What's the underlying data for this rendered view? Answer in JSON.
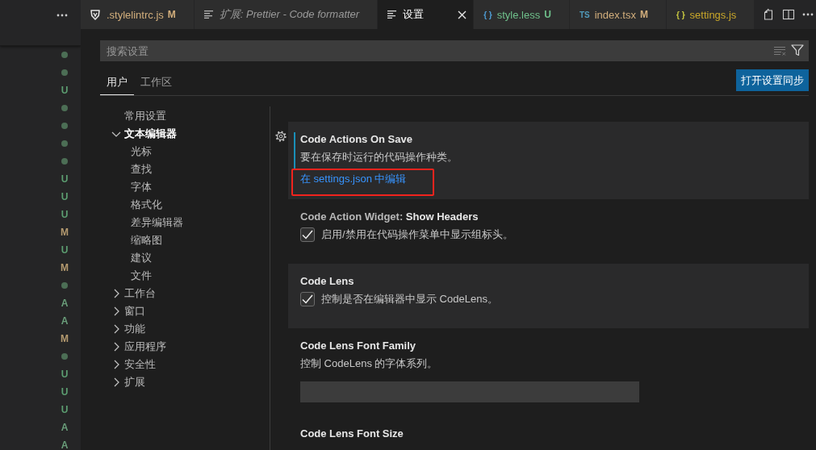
{
  "explorer": {
    "decorations": [
      {
        "kind": "dot",
        "color": "#4c6e55"
      },
      {
        "kind": "dot",
        "color": "#4c6e55"
      },
      {
        "kind": "letter",
        "label": "U",
        "color": "#5c9e71"
      },
      {
        "kind": "dot",
        "color": "#4c6e55"
      },
      {
        "kind": "dot",
        "color": "#4c6e55"
      },
      {
        "kind": "dot",
        "color": "#4c6e55"
      },
      {
        "kind": "dot",
        "color": "#4c6e55"
      },
      {
        "kind": "letter",
        "label": "U",
        "color": "#5c9e71"
      },
      {
        "kind": "letter",
        "label": "U",
        "color": "#5c9e71"
      },
      {
        "kind": "letter",
        "label": "U",
        "color": "#5c9e71"
      },
      {
        "kind": "letter",
        "label": "M",
        "color": "#b49a6f"
      },
      {
        "kind": "letter",
        "label": "U",
        "color": "#5c9e71"
      },
      {
        "kind": "letter",
        "label": "M",
        "color": "#b49a6f"
      },
      {
        "kind": "dot",
        "color": "#4c6e55"
      },
      {
        "kind": "letter",
        "label": "A",
        "color": "#6a9e7a"
      },
      {
        "kind": "letter",
        "label": "A",
        "color": "#6a9e7a"
      },
      {
        "kind": "letter",
        "label": "M",
        "color": "#b49a6f"
      },
      {
        "kind": "dot",
        "color": "#4c6e55"
      },
      {
        "kind": "letter",
        "label": "U",
        "color": "#5c9e71"
      },
      {
        "kind": "letter",
        "label": "U",
        "color": "#5c9e71"
      },
      {
        "kind": "letter",
        "label": "U",
        "color": "#5c9e71"
      },
      {
        "kind": "letter",
        "label": "A",
        "color": "#6a9e7a"
      },
      {
        "kind": "letter",
        "label": "A",
        "color": "#6a9e7a"
      }
    ]
  },
  "editor": {
    "tabs": [
      {
        "kind": "stylelint",
        "label": ".stylelintrc.js",
        "status": "M",
        "color": "#d2ae7c",
        "preview": false,
        "selected": false
      },
      {
        "kind": "page",
        "label": "扩展: Prettier - Code formatter",
        "color": "#9a9a9a",
        "preview": true,
        "selected": false
      },
      {
        "kind": "page",
        "label": "设置",
        "color": "#ffffff",
        "preview": false,
        "selected": true
      },
      {
        "kind": "less",
        "icon_text": "{ }",
        "label": "style.less",
        "status": "U",
        "color": "#6fc08b",
        "preview": false,
        "selected": false
      },
      {
        "kind": "typescript",
        "icon_text": "TS",
        "label": "index.tsx",
        "status": "M",
        "color": "#d2ae7c",
        "preview": false,
        "selected": false
      },
      {
        "kind": "json",
        "icon_text": "{ }",
        "label": "settings.js",
        "color": "#c9a72a",
        "preview": false,
        "selected": false
      }
    ]
  },
  "settings": {
    "search": {
      "placeholder": "搜索设置"
    },
    "scopes": [
      {
        "label": "用户",
        "selected": true
      },
      {
        "label": "工作区",
        "selected": false
      }
    ],
    "sync_button": "打开设置同步",
    "toc": [
      {
        "label": "常用设置",
        "selected": false
      },
      {
        "label": "文本编辑器",
        "selected": true,
        "expanded": true,
        "children": [
          {
            "label": "光标",
            "selected": false
          },
          {
            "label": "查找",
            "selected": false
          },
          {
            "label": "字体",
            "selected": false
          },
          {
            "label": "格式化",
            "selected": false
          },
          {
            "label": "差异编辑器",
            "selected": false
          },
          {
            "label": "缩略图",
            "selected": false
          },
          {
            "label": "建议",
            "selected": false
          },
          {
            "label": "文件",
            "selected": false
          }
        ]
      },
      {
        "label": "工作台",
        "selected": false,
        "expanded": false
      },
      {
        "label": "窗口",
        "selected": false,
        "expanded": false
      },
      {
        "label": "功能",
        "selected": false,
        "expanded": false
      },
      {
        "label": "应用程序",
        "selected": false,
        "expanded": false
      },
      {
        "label": "安全性",
        "selected": false,
        "expanded": false
      },
      {
        "label": "扩展",
        "selected": false,
        "expanded": false
      }
    ],
    "items": [
      {
        "kind": "object",
        "title": "Code Actions On Save",
        "description": "要在保存时运行的代码操作种类。",
        "link": {
          "text": "在 settings.json 中编辑",
          "annotated": true
        },
        "modified": true,
        "focused": true,
        "hovered": true
      },
      {
        "kind": "checkbox",
        "category": "Code Action Widget:",
        "title": "Show Headers",
        "description": "启用/禁用在代码操作菜单中显示组标头。",
        "checked": true,
        "modified": false,
        "focused": false,
        "hovered": false
      },
      {
        "kind": "checkbox",
        "title": "Code Lens",
        "description": "控制是否在编辑器中显示 CodeLens。",
        "checked": true,
        "modified": false,
        "focused": false,
        "hovered": true
      },
      {
        "kind": "text",
        "title": "Code Lens Font Family",
        "description": "控制 CodeLens 的字体系列。",
        "modified": false,
        "focused": false,
        "hovered": false
      },
      {
        "kind": "title",
        "title": "Code Lens Font Size",
        "modified": false,
        "focused": false,
        "hovered": false
      }
    ]
  }
}
